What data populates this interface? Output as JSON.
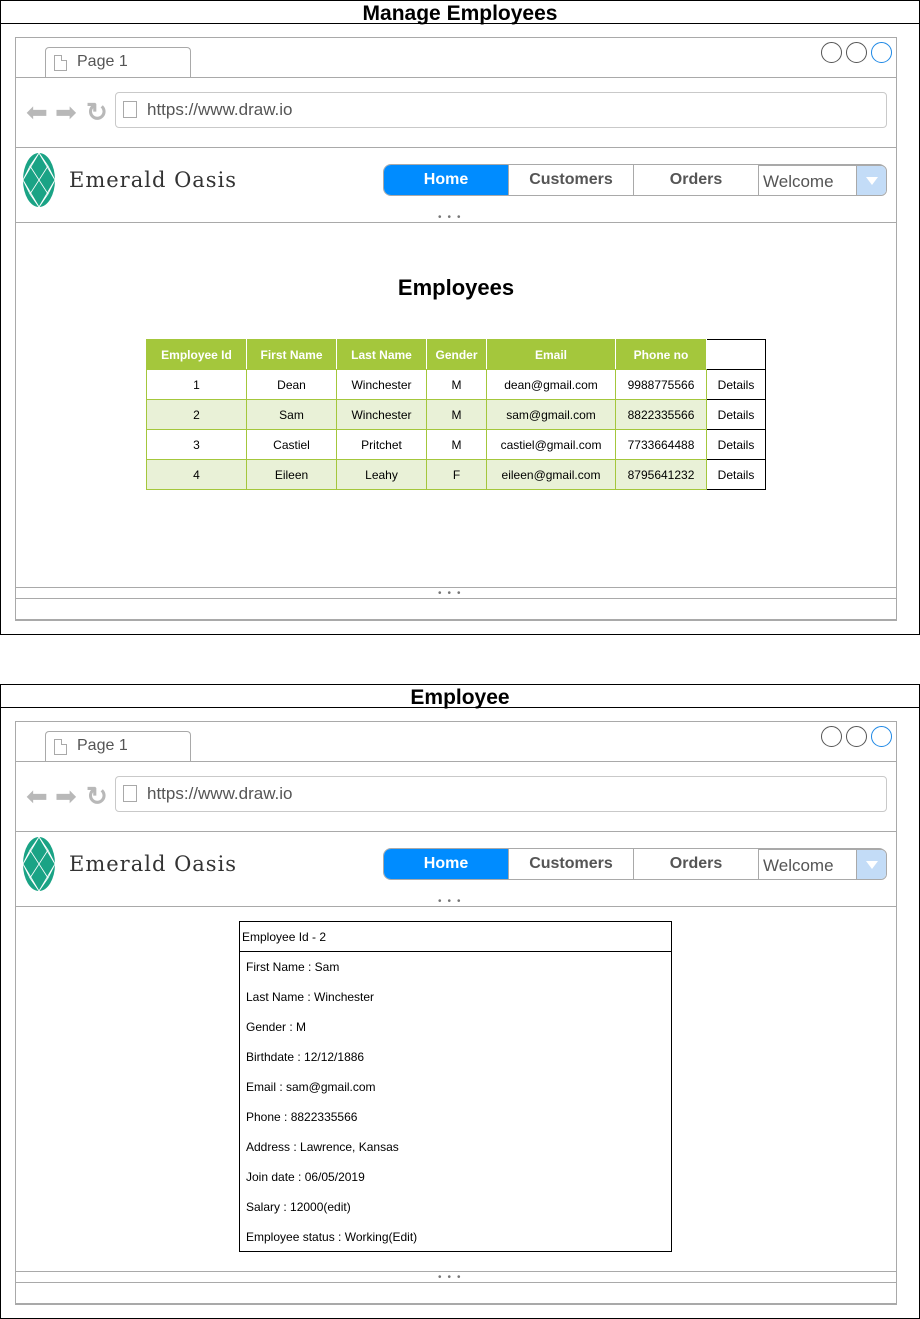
{
  "colors": {
    "accent": "#008cff",
    "table_header": "#a4c73c",
    "table_alt_row": "#e9f1d7",
    "emerald": "#1aa385"
  },
  "screens": [
    {
      "title": "Manage Employees",
      "tab_label": "Page 1",
      "url": "https://www.draw.io",
      "brand": "Emerald Oasis",
      "nav": [
        "Home",
        "Customers",
        "Orders"
      ],
      "welcome": "Welcome",
      "heading": "Employees",
      "table": {
        "headers": [
          "Employee Id",
          "First Name",
          "Last Name",
          "Gender",
          "Email",
          "Phone no"
        ],
        "rows": [
          [
            "1",
            "Dean",
            "Winchester",
            "M",
            "dean@gmail.com",
            "9988775566",
            "Details"
          ],
          [
            "2",
            "Sam",
            "Winchester",
            "M",
            "sam@gmail.com",
            "8822335566",
            "Details"
          ],
          [
            "3",
            "Castiel",
            "Pritchet",
            "M",
            "castiel@gmail.com",
            "7733664488",
            "Details"
          ],
          [
            "4",
            "Eileen",
            "Leahy",
            "F",
            "eileen@gmail.com",
            "8795641232",
            "Details"
          ]
        ]
      }
    },
    {
      "title": "Employee",
      "tab_label": "Page 1",
      "url": "https://www.draw.io",
      "brand": "Emerald Oasis",
      "nav": [
        "Home",
        "Customers",
        "Orders"
      ],
      "welcome": "Welcome",
      "detail": {
        "header": "Employee Id - 2",
        "lines": [
          "First Name : Sam",
          "Last Name : Winchester",
          "Gender : M",
          "Birthdate : 12/12/1886",
          "Email : sam@gmail.com",
          "Phone : 8822335566",
          "Address : Lawrence, Kansas",
          "Join date : 06/05/2019",
          "Salary : 12000(edit)",
          "Employee status : Working(Edit)"
        ]
      }
    }
  ]
}
